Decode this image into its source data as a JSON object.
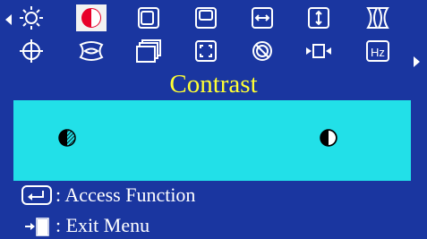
{
  "menu": {
    "title": "Contrast",
    "icons_row1": [
      {
        "name": "brightness-icon",
        "selected": false
      },
      {
        "name": "contrast-icon",
        "selected": true
      },
      {
        "name": "h-position-icon",
        "selected": false
      },
      {
        "name": "v-position-icon",
        "selected": false
      },
      {
        "name": "h-size-icon",
        "selected": false
      },
      {
        "name": "v-size-icon",
        "selected": false
      },
      {
        "name": "pincushion-icon",
        "selected": false
      }
    ],
    "icons_row2": [
      {
        "name": "rotation-icon",
        "selected": false
      },
      {
        "name": "trapezoid-icon",
        "selected": false
      },
      {
        "name": "recall-icon",
        "selected": false
      },
      {
        "name": "zoom-icon",
        "selected": false
      },
      {
        "name": "degauss-icon",
        "selected": false
      },
      {
        "name": "input-icon",
        "selected": false
      },
      {
        "name": "hz-icon",
        "selected": false,
        "label": "Hz"
      }
    ]
  },
  "slider": {
    "low_icon": "contrast-low-icon",
    "high_icon": "contrast-high-icon"
  },
  "hints": {
    "access_label": ": Access Function",
    "exit_label": ": Exit Menu"
  },
  "colors": {
    "background": "#1a36a0",
    "panel": "#22e0e8",
    "title": "#ffff33",
    "selected": "#e8002a",
    "icon": "#ffffff"
  }
}
